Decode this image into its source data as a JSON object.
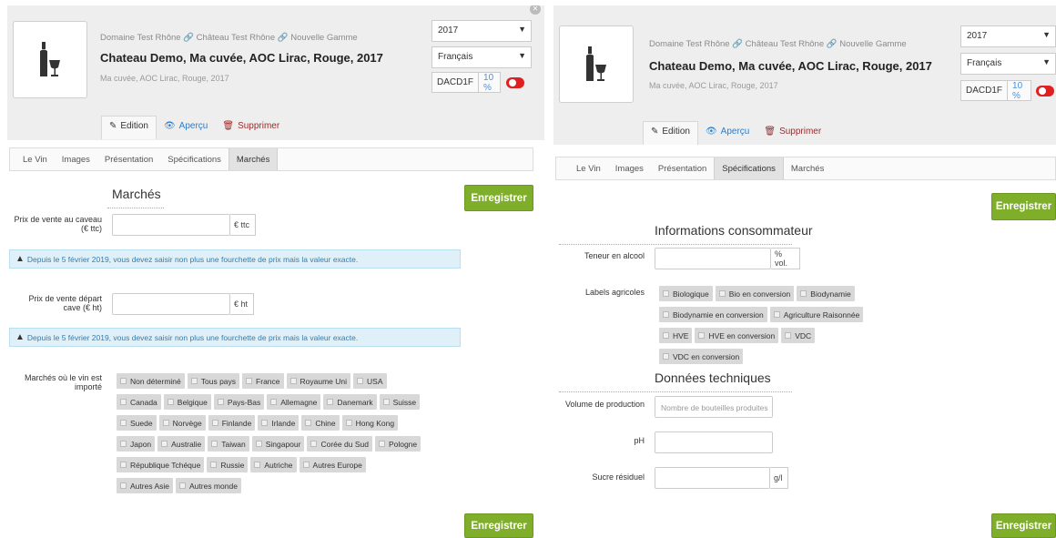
{
  "left": {
    "crumbs": [
      "Domaine Test Rhône",
      "Château Test Rhône",
      "Nouvelle Gamme"
    ],
    "title": "Chateau Demo, Ma cuvée, AOC Lirac, Rouge, 2017",
    "subtitle": "Ma cuvée, AOC Lirac, Rouge, 2017",
    "year_select": "2017",
    "lang_select": "Français",
    "code": "DACD1F",
    "percent": "10 %",
    "actions": {
      "edit": "Edition",
      "preview": "Aperçu",
      "delete": "Supprimer"
    },
    "tabs": [
      "Le Vin",
      "Images",
      "Présentation",
      "Spécifications",
      "Marchés"
    ],
    "active_tab": "Marchés",
    "section_title": "Marchés",
    "save_label": "Enregistrer",
    "fields": {
      "caveau_label": "Prix de vente au caveau (€ ttc)",
      "caveau_unit": "€ ttc",
      "depart_label": "Prix de vente départ cave (€ ht)",
      "depart_unit": "€ ht",
      "alert_text": "Depuis le 5 février 2019, vous devez saisir non plus une fourchette de prix mais la valeur exacte.",
      "markets_label": "Marchés où le vin est importé"
    },
    "markets": [
      "Non déterminé",
      "Tous pays",
      "France",
      "Royaume Uni",
      "USA",
      "Canada",
      "Belgique",
      "Pays-Bas",
      "Allemagne",
      "Danemark",
      "Suisse",
      "Suede",
      "Norvège",
      "Finlande",
      "Irlande",
      "Chine",
      "Hong Kong",
      "Japon",
      "Australie",
      "Taiwan",
      "Singapour",
      "Corée du Sud",
      "Pologne",
      "République Tchéque",
      "Russie",
      "Autriche",
      "Autres Europe",
      "Autres Asie",
      "Autres monde"
    ]
  },
  "right": {
    "crumbs": [
      "Domaine Test Rhône",
      "Château Test Rhône",
      "Nouvelle Gamme"
    ],
    "title": "Chateau Demo, Ma cuvée, AOC Lirac, Rouge, 2017",
    "subtitle": "Ma cuvée, AOC Lirac, Rouge, 2017",
    "year_select": "2017",
    "lang_select": "Français",
    "code": "DACD1F",
    "percent": "10 %",
    "actions": {
      "edit": "Edition",
      "preview": "Aperçu",
      "delete": "Supprimer"
    },
    "tabs": [
      "Le Vin",
      "Images",
      "Présentation",
      "Spécifications",
      "Marchés"
    ],
    "active_tab": "Spécifications",
    "save_label": "Enregistrer",
    "consumer_title": "Informations consommateur",
    "alcohol_label": "Teneur en alcool",
    "alcohol_unit": "% vol.",
    "labels_label": "Labels agricoles",
    "agri_labels": [
      "Biologique",
      "Bio en conversion",
      "Biodynamie",
      "Biodynamie en conversion",
      "Agriculture Raisonnée",
      "HVE",
      "HVE en conversion",
      "VDC",
      "VDC en conversion"
    ],
    "tech_title": "Données techniques",
    "volume_label": "Volume de production",
    "volume_placeholder": "Nombre de bouteilles produites",
    "ph_label": "pH",
    "sugar_label": "Sucre résiduel",
    "sugar_unit": "g/l"
  },
  "colors": {
    "accent_green": "#7fae2a",
    "toggle_red": "#e02020",
    "link_blue": "#2f7cc4",
    "delete_red": "#9a2b2b"
  },
  "icons": [
    "bottle-glass-icon",
    "pencil-icon",
    "eye-icon",
    "trash-icon",
    "link-icon",
    "warning-icon",
    "chevron-down-icon"
  ]
}
